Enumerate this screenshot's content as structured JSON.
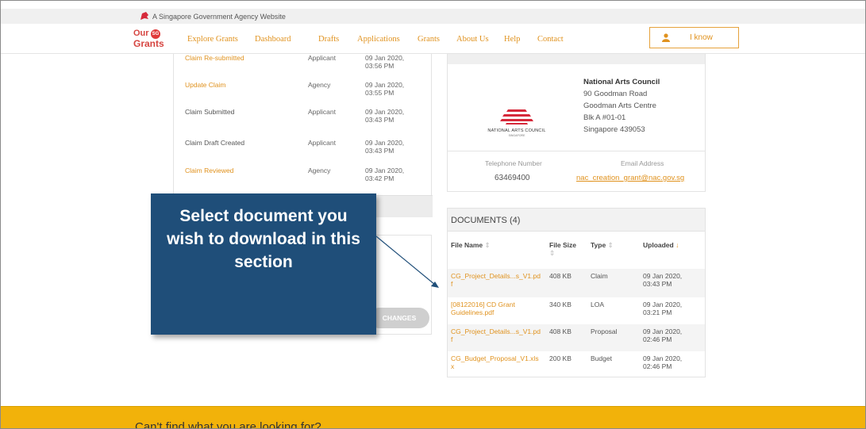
{
  "gov_bar": {
    "text": "A Singapore Government Agency Website"
  },
  "logo": {
    "line1": "Our",
    "badge": "SG",
    "line2": "Grants"
  },
  "nav": {
    "items": [
      "Explore Grants",
      "Dashboard",
      "Drafts",
      "Applications",
      "Grants",
      "About Us",
      "Help",
      "Contact"
    ]
  },
  "user": {
    "name": "I know",
    "icon": "user-icon"
  },
  "history": {
    "rows": [
      {
        "action": "Claim Re-submitted",
        "by": "Applicant",
        "date": "09 Jan 2020,",
        "time": "03:56 PM",
        "highlight": true
      },
      {
        "action": "Update Claim",
        "by": "Agency",
        "date": "09 Jan 2020,",
        "time": "03:55 PM",
        "highlight": true
      },
      {
        "action": "Claim Submitted",
        "by": "Applicant",
        "date": "09 Jan 2020,",
        "time": "03:43 PM",
        "highlight": false
      },
      {
        "action": "Claim Draft Created",
        "by": "Applicant",
        "date": "09 Jan 2020,",
        "time": "03:43 PM",
        "highlight": false
      },
      {
        "action": "Claim Reviewed",
        "by": "Agency",
        "date": "09 Jan 2020,",
        "time": "03:42 PM",
        "highlight": true
      }
    ]
  },
  "changes_button": "CHANGES",
  "agency": {
    "logo_text": "NATIONAL ARTS COUNCIL",
    "logo_sub": "SINGAPORE",
    "name": "National Arts Council",
    "address": [
      "90 Goodman Road",
      "Goodman Arts Centre",
      "Blk A #01-01",
      "Singapore 439053"
    ],
    "tel_label": "Telephone Number",
    "tel": "63469400",
    "email_label": "Email Address",
    "email": "nac_creation_grant@nac.gov.sg"
  },
  "documents": {
    "title": "DOCUMENTS (4)",
    "headers": {
      "file_name": "File Name",
      "file_size": "File Size",
      "type": "Type",
      "uploaded": "Uploaded"
    },
    "rows": [
      {
        "name1": "CG_Project_Details...s_V1.pd",
        "name2": "f",
        "size": "408 KB",
        "type": "Claim",
        "date": "09 Jan 2020,",
        "time": "03:43 PM"
      },
      {
        "name1": "[08122016] CD Grant",
        "name2": "Guidelines.pdf",
        "size": "340 KB",
        "type": "LOA",
        "date": "09 Jan 2020,",
        "time": "03:21 PM"
      },
      {
        "name1": "CG_Project_Details...s_V1.pd",
        "name2": "f",
        "size": "408 KB",
        "type": "Proposal",
        "date": "09 Jan 2020,",
        "time": "02:46 PM"
      },
      {
        "name1": "CG_Budget_Proposal_V1.xls",
        "name2": "x",
        "size": "200 KB",
        "type": "Budget",
        "date": "09 Jan 2020,",
        "time": "02:46 PM"
      }
    ]
  },
  "callout": {
    "text": "Select document you wish to download in this section"
  },
  "footer": {
    "text": "Can't find what you are looking for?"
  },
  "colors": {
    "accent": "#e0921e",
    "callout": "#1f4e79",
    "footer": "#f2b20a"
  }
}
